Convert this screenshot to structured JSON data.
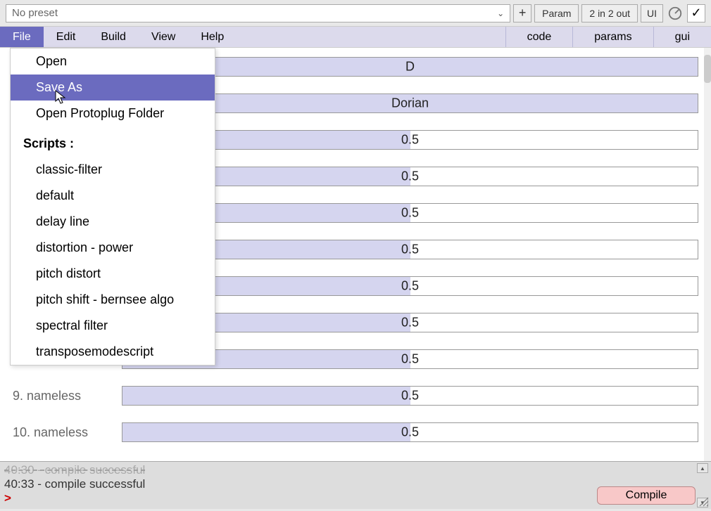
{
  "toolbar": {
    "preset_label": "No preset",
    "plus": "+",
    "param_btn": "Param",
    "io_btn": "2 in 2 out",
    "ui_btn": "UI"
  },
  "menubar": {
    "file": "File",
    "edit": "Edit",
    "build": "Build",
    "view": "View",
    "help": "Help",
    "tab_code": "code",
    "tab_params": "params",
    "tab_gui": "gui"
  },
  "file_menu": {
    "open": "Open",
    "save_as": "Save As",
    "open_folder": "Open Protoplug Folder",
    "scripts_header": "Scripts :",
    "scripts": [
      "classic-filter",
      "default",
      "delay line",
      "distortion - power",
      "pitch distort",
      "pitch shift - bernsee algo",
      "spectral filter",
      "transposemodescript"
    ]
  },
  "params": [
    {
      "label": "",
      "value": "D",
      "fill_pct": 100
    },
    {
      "label": "",
      "value": "Dorian",
      "fill_pct": 100
    },
    {
      "label": "",
      "value": "0.5",
      "fill_pct": 50
    },
    {
      "label": "",
      "value": "0.5",
      "fill_pct": 50
    },
    {
      "label": "",
      "value": "0.5",
      "fill_pct": 50
    },
    {
      "label": "",
      "value": "0.5",
      "fill_pct": 50
    },
    {
      "label": "",
      "value": "0.5",
      "fill_pct": 50
    },
    {
      "label": "",
      "value": "0.5",
      "fill_pct": 50
    },
    {
      "label": "",
      "value": "0.5",
      "fill_pct": 50
    },
    {
      "label": "9. nameless",
      "value": "0.5",
      "fill_pct": 50
    },
    {
      "label": "10. nameless",
      "value": "0.5",
      "fill_pct": 50
    }
  ],
  "log": {
    "line0": "40:30 - compile successful",
    "line1": "40:33 - compile successful",
    "prompt": ">"
  },
  "compile_btn": "Compile"
}
